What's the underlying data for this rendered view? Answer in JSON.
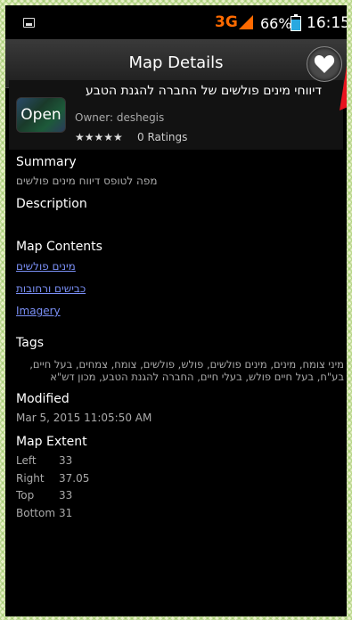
{
  "status_bar": {
    "network": "3G",
    "battery_percent": "66%",
    "time": "16:15"
  },
  "header": {
    "title": "Map Details"
  },
  "map": {
    "title": "דיווחי מינים פולשים של החברה להגנת הטבע",
    "owner": "Owner: deshegis",
    "stars": "★★★★★",
    "ratings": "0 Ratings",
    "open_label": "Open"
  },
  "summary": {
    "heading": "Summary",
    "text": "מפה לטופס דיווח מינים פולשים"
  },
  "description": {
    "heading": "Description"
  },
  "map_contents": {
    "heading": "Map Contents",
    "items": [
      "מינים פולשים",
      "כבישים ורחובות",
      "Imagery"
    ]
  },
  "tags": {
    "heading": "Tags",
    "text": "מיני צומח, מינים, מינים פולשים, פולש, פולשים, צומח, צמחים, בעל חיים, בע\"ח, בעל חיים פולש, בעלי חיים, החברה להגנת הטבע, מכון דש\"א"
  },
  "modified": {
    "heading": "Modified",
    "value": "Mar 5, 2015 11:05:50 AM"
  },
  "extent": {
    "heading": "Map Extent",
    "rows": [
      {
        "label": "Left",
        "value": "33"
      },
      {
        "label": "Right",
        "value": "37.05"
      },
      {
        "label": "Top",
        "value": "33"
      },
      {
        "label": "Bottom",
        "value": "31"
      }
    ]
  },
  "colors": {
    "accent_link": "#7a8ff5",
    "network_orange": "#ff6a00",
    "battery_blue": "#29a8e0",
    "arrow_red": "#e8141e"
  },
  "icons": [
    "image-icon",
    "signal-icon",
    "battery-icon",
    "heart-icon"
  ]
}
